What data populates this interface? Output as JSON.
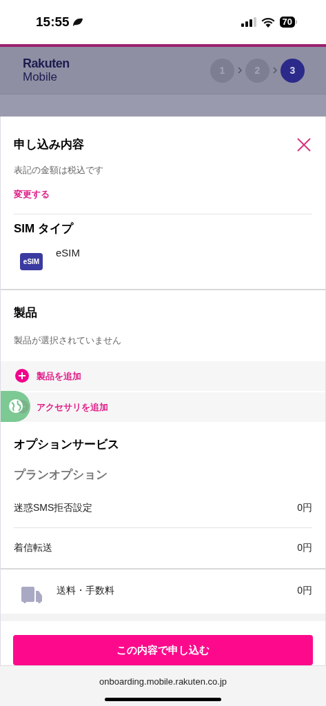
{
  "status_bar": {
    "time": "15:55",
    "battery": "70"
  },
  "header": {
    "logo_line_1": "Rakuten",
    "logo_line_2": "Mobile",
    "steps": [
      {
        "label": "1",
        "selected": false
      },
      {
        "label": "2",
        "selected": false
      },
      {
        "label": "3",
        "selected": true
      }
    ]
  },
  "sheet": {
    "title": "申し込み内容",
    "note": "表記の金額は税込です",
    "change_link": "変更する",
    "sim_section": {
      "title": "SIM タイプ",
      "badge": "eSIM",
      "value": "eSIM"
    },
    "product_section": {
      "title": "製品",
      "empty_text": "製品が選択されていません",
      "actions": [
        {
          "label": "製品を追加",
          "covered": false
        },
        {
          "label": "アクセサリを追加",
          "covered": true
        }
      ]
    },
    "options_section": {
      "title": "オプションサービス",
      "subtitle": "プランオプション",
      "rows": [
        {
          "label": "迷惑SMS拒否設定",
          "price": "0円"
        },
        {
          "label": "着信転送",
          "price": "0円"
        }
      ]
    },
    "shipping": {
      "label": "送料・手数料",
      "price": "0円"
    },
    "submit_button": "この内容で申し込む"
  },
  "browser_bar": {
    "url": "onboarding.mobile.rakuten.co.jp"
  }
}
